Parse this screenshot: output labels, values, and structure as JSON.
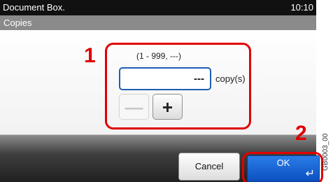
{
  "header": {
    "title": "Document Box.",
    "time": "10:10"
  },
  "subheader": {
    "title": "Copies"
  },
  "callouts": {
    "one": "1",
    "two": "2"
  },
  "copies": {
    "range": "(1 - 999, ---)",
    "value": "---",
    "unit": "copy(s)",
    "minus_label": "—",
    "plus_label": "+"
  },
  "footer": {
    "cancel_label": "Cancel",
    "ok_label": "OK",
    "enter_glyph": "↵"
  },
  "side_code": "GB0003_00",
  "colors": {
    "accent": "#e00000",
    "field_border": "#1e5fb4",
    "ok_blue": "#1a5fd0"
  }
}
